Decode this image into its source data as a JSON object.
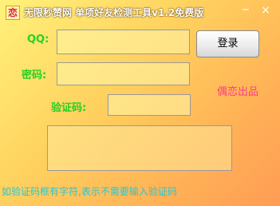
{
  "window": {
    "title": "无限秒赞网 单项好友检测工具v1.2免费版",
    "icon_glyph": "恋",
    "minimize_glyph": "−",
    "close_glyph": "×"
  },
  "form": {
    "qq_label": "QQ:",
    "qq_value": "",
    "password_label": "密码:",
    "password_value": "",
    "captcha_label": "验证码:",
    "captcha_value": "",
    "login_label": "登录"
  },
  "brand_text": "偶恋出品",
  "info_box_text": "",
  "tip_text": "如验证码框有字符,表示不需要输入验证码",
  "colors": {
    "label_green": "#22d322",
    "brand_pink": "#ff3a8a",
    "tip_cyan": "#22c8d8"
  }
}
